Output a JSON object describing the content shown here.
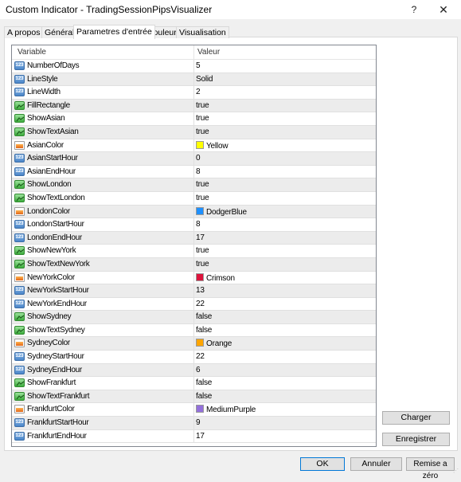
{
  "window": {
    "title": "Custom Indicator - TradingSessionPipsVisualizer",
    "help_label": "?",
    "close_label": "✕"
  },
  "tabs": [
    {
      "label": "A propos",
      "active": false
    },
    {
      "label": "Général",
      "active": false
    },
    {
      "label": "Parametres d'entrée",
      "active": true
    },
    {
      "label": "Couleur",
      "active": false
    },
    {
      "label": "Visualisation",
      "active": false
    }
  ],
  "grid": {
    "headers": {
      "variable": "Variable",
      "value": "Valeur"
    },
    "rows": [
      {
        "type": "number",
        "name": "NumberOfDays",
        "value": "5"
      },
      {
        "type": "number",
        "name": "LineStyle",
        "value": "Solid"
      },
      {
        "type": "number",
        "name": "LineWidth",
        "value": "2"
      },
      {
        "type": "bool",
        "name": "FillRectangle",
        "value": "true"
      },
      {
        "type": "bool",
        "name": "ShowAsian",
        "value": "true"
      },
      {
        "type": "bool",
        "name": "ShowTextAsian",
        "value": "true"
      },
      {
        "type": "color",
        "name": "AsianColor",
        "value": "Yellow",
        "swatch": "#ffff00"
      },
      {
        "type": "number",
        "name": "AsianStartHour",
        "value": "0"
      },
      {
        "type": "number",
        "name": "AsianEndHour",
        "value": "8"
      },
      {
        "type": "bool",
        "name": "ShowLondon",
        "value": "true"
      },
      {
        "type": "bool",
        "name": "ShowTextLondon",
        "value": "true"
      },
      {
        "type": "color",
        "name": "LondonColor",
        "value": "DodgerBlue",
        "swatch": "#1e90ff"
      },
      {
        "type": "number",
        "name": "LondonStartHour",
        "value": "8"
      },
      {
        "type": "number",
        "name": "LondonEndHour",
        "value": "17"
      },
      {
        "type": "bool",
        "name": "ShowNewYork",
        "value": "true"
      },
      {
        "type": "bool",
        "name": "ShowTextNewYork",
        "value": "true"
      },
      {
        "type": "color",
        "name": "NewYorkColor",
        "value": "Crimson",
        "swatch": "#dc143c"
      },
      {
        "type": "number",
        "name": "NewYorkStartHour",
        "value": "13"
      },
      {
        "type": "number",
        "name": "NewYorkEndHour",
        "value": "22"
      },
      {
        "type": "bool",
        "name": "ShowSydney",
        "value": "false"
      },
      {
        "type": "bool",
        "name": "ShowTextSydney",
        "value": "false"
      },
      {
        "type": "color",
        "name": "SydneyColor",
        "value": "Orange",
        "swatch": "#ffa500"
      },
      {
        "type": "number",
        "name": "SydneyStartHour",
        "value": "22"
      },
      {
        "type": "number",
        "name": "SydneyEndHour",
        "value": "6"
      },
      {
        "type": "bool",
        "name": "ShowFrankfurt",
        "value": "false"
      },
      {
        "type": "bool",
        "name": "ShowTextFrankfurt",
        "value": "false"
      },
      {
        "type": "color",
        "name": "FrankfurtColor",
        "value": "MediumPurple",
        "swatch": "#9370db"
      },
      {
        "type": "number",
        "name": "FrankfurtStartHour",
        "value": "9"
      },
      {
        "type": "number",
        "name": "FrankfurtEndHour",
        "value": "17"
      }
    ]
  },
  "side_buttons": {
    "load": "Charger",
    "save": "Enregistrer"
  },
  "footer_buttons": {
    "ok": "OK",
    "cancel": "Annuler",
    "reset": "Remise a zéro"
  },
  "icons": {
    "number": "123",
    "bool": "bool-chart-icon",
    "color": "color-palette-icon"
  }
}
